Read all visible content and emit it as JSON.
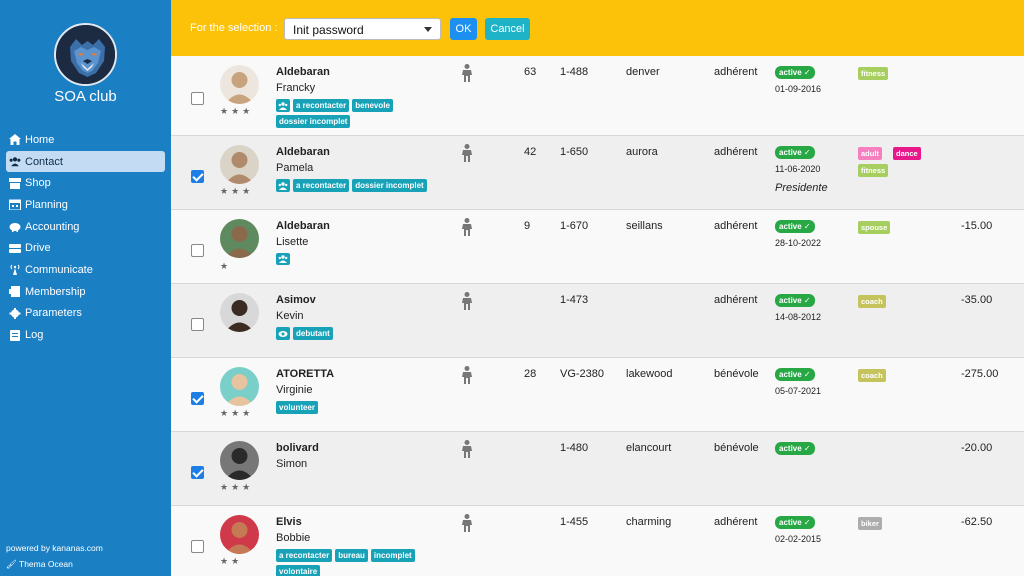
{
  "sidebar": {
    "club_name": "SOA club",
    "items": [
      {
        "label": "Home",
        "icon": "home-icon"
      },
      {
        "label": "Contact",
        "icon": "users-icon"
      },
      {
        "label": "Shop",
        "icon": "shop-icon"
      },
      {
        "label": "Planning",
        "icon": "calendar-icon"
      },
      {
        "label": "Accounting",
        "icon": "piggy-bank-icon"
      },
      {
        "label": "Drive",
        "icon": "drive-icon"
      },
      {
        "label": "Communicate",
        "icon": "broadcast-icon"
      },
      {
        "label": "Membership",
        "icon": "id-card-icon"
      },
      {
        "label": "Parameters",
        "icon": "gear-icon"
      },
      {
        "label": "Log",
        "icon": "log-icon"
      }
    ],
    "footer_powered": "powered by kananas.com",
    "footer_theme": "Thema Ocean"
  },
  "topbar": {
    "label": "For the selection :",
    "select_value": "Init password",
    "ok_label": "OK",
    "cancel_label": "Cancel"
  },
  "colors": {
    "sidebar": "#1b7fc4",
    "topbar": "#fcc20a",
    "tag_teal": "#17a2b8",
    "status_green": "#28a745",
    "tag_lime": "#a6cf5f",
    "tag_pink": "#f57fbf",
    "tag_magenta": "#e8178a",
    "tag_olive": "#c5c35e",
    "tag_grey": "#adadad"
  },
  "rows": [
    {
      "checked": false,
      "stars": "★★★",
      "last": "Aldebaran",
      "first": "Francky",
      "tags": [
        "group-icon",
        "a recontacter",
        "benevole",
        "dossier incomplet"
      ],
      "num": "63",
      "member": "1-488",
      "city": "denver",
      "role": "adhérent",
      "status": "active ✓",
      "date": "01-09-2016",
      "note": "",
      "ctags": [
        {
          "label": "fitness",
          "color": "#a6cf5f"
        }
      ],
      "amount": ""
    },
    {
      "checked": true,
      "stars": "★★★",
      "last": "Aldebaran",
      "first": "Pamela",
      "tags": [
        "group-icon",
        "a recontacter",
        "dossier incomplet"
      ],
      "num": "42",
      "member": "1-650",
      "city": "aurora",
      "role": "adhérent",
      "status": "active ✓",
      "date": "11-06-2020",
      "note": "Presidente",
      "ctags": [
        {
          "label": "adult",
          "color": "#f57fbf"
        },
        {
          "label": "dance",
          "color": "#e8178a"
        },
        {
          "label": "fitness",
          "color": "#a6cf5f"
        }
      ],
      "amount": ""
    },
    {
      "checked": false,
      "stars": "★",
      "last": "Aldebaran",
      "first": "Lisette",
      "tags": [
        "group-icon"
      ],
      "num": "9",
      "member": "1-670",
      "city": "seillans",
      "role": "adhérent",
      "status": "active ✓",
      "date": "28-10-2022",
      "note": "",
      "ctags": [
        {
          "label": "spouse",
          "color": "#a6cf5f"
        }
      ],
      "amount": "-15.00"
    },
    {
      "checked": false,
      "stars": "",
      "last": "Asimov",
      "first": "Kevin",
      "tags": [
        "eye-icon",
        "debutant"
      ],
      "num": "",
      "member": "1-473",
      "city": "",
      "role": "adhérent",
      "status": "active ✓",
      "date": "14-08-2012",
      "note": "",
      "ctags": [
        {
          "label": "coach",
          "color": "#c5c35e"
        }
      ],
      "amount": "-35.00"
    },
    {
      "checked": true,
      "stars": "★★★",
      "last": "ATORETTA",
      "first": "Virginie",
      "tags": [
        "volunteer"
      ],
      "num": "28",
      "member": "VG-2380",
      "city": "lakewood",
      "role": "bénévole",
      "status": "active ✓",
      "date": "05-07-2021",
      "note": "",
      "ctags": [
        {
          "label": "coach",
          "color": "#c5c35e"
        }
      ],
      "amount": "-275.00"
    },
    {
      "checked": true,
      "stars": "★★★",
      "last": "bolivard",
      "first": "Simon",
      "tags": [],
      "num": "",
      "member": "1-480",
      "city": "elancourt",
      "role": "bénévole",
      "status": "active ✓",
      "date": "",
      "note": "",
      "ctags": [],
      "amount": "-20.00"
    },
    {
      "checked": false,
      "stars": "★★",
      "last": "Elvis",
      "first": "Bobbie",
      "tags": [
        "a recontacter",
        "bureau",
        "incomplet",
        "volontaire"
      ],
      "num": "",
      "member": "1-455",
      "city": "charming",
      "role": "adhérent",
      "status": "active ✓",
      "date": "02-02-2015",
      "note": "",
      "ctags": [
        {
          "label": "biker",
          "color": "#adadad"
        }
      ],
      "amount": "-62.50"
    }
  ]
}
